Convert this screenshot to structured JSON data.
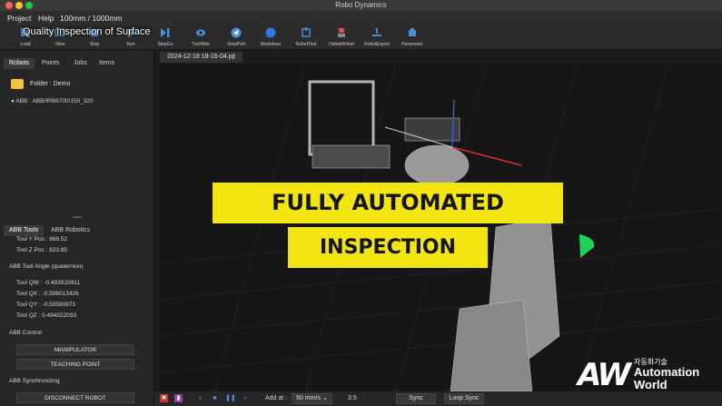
{
  "window": {
    "title": "Robo Dynamics"
  },
  "menu": [
    "Project",
    "Help",
    "100mm / 1000mm"
  ],
  "toolbar": [
    {
      "label": "Load",
      "icon": "load-icon",
      "color": "#4a90d9"
    },
    {
      "label": "View",
      "icon": "view-icon",
      "color": "#4a90d9"
    },
    {
      "label": "Stop",
      "icon": "stop-icon",
      "color": "#4a90d9"
    },
    {
      "label": "Run",
      "icon": "run-icon",
      "color": "#4a90d9"
    },
    {
      "label": "StepGo",
      "icon": "step-icon",
      "color": "#4a90d9"
    },
    {
      "label": "ToolHide",
      "icon": "eye-icon",
      "color": "#4a90d9"
    },
    {
      "label": "ViewPort",
      "icon": "send-icon",
      "color": "#4a90d9"
    },
    {
      "label": "WorkArea",
      "icon": "globe-icon",
      "color": "#2d7be0"
    },
    {
      "label": "RobotTool",
      "icon": "tool-icon",
      "color": "#4a90d9"
    },
    {
      "label": "DeleteRobot",
      "icon": "robot-icon",
      "color": "#d9534f"
    },
    {
      "label": "RobotExport",
      "icon": "export-icon",
      "color": "#4a90d9"
    },
    {
      "label": "Parameter",
      "icon": "parameter-icon",
      "color": "#4a90d9"
    }
  ],
  "overlay_title": "Quality Inspection of Surface",
  "left_tabs": [
    "Robots",
    "Points",
    "Jobs",
    "Items"
  ],
  "tree": {
    "folder": "Folder : Demo",
    "robot": "ABB : ABB/IRB6700/150_320"
  },
  "props_tabs": [
    "ABB Tools",
    "ABB Robotics"
  ],
  "props": {
    "tool_y": "Tool Y Pos : 866.52",
    "tool_z": "Tool Z Pos : 823.85",
    "angle_header": "ABB Tool Angle (quaternion)",
    "qw": "Tool QW : -0.493910911",
    "qx": "Tool QX : -0.506013426",
    "qy": "Tool QY : -0.50590973",
    "qz": "Tool QZ : 0.494022033",
    "control_header": "ABB Control",
    "manipulator": "MANIPULATOR",
    "teaching": "TEACHING POINT",
    "sync_header": "ABB Synchronizing",
    "disconnect": "DISCONNECT ROBOT"
  },
  "file_tab": "2024-12-18 18-16-04.pjt",
  "banners": {
    "line1": "FULLY AUTOMATED",
    "line2": "INSPECTION"
  },
  "bottom": {
    "add_at_label": "Add at :",
    "speed": "50 mm/s",
    "value": "3.5",
    "sync": "Sync",
    "loop_sync": "Loop Sync"
  },
  "watermark": {
    "korean": "자동화기술",
    "line1": "Automation",
    "line2": "World",
    "logo": "AW"
  },
  "colors": {
    "banner": "#f2e512",
    "accent": "#4a90d9",
    "folder": "#f5c242",
    "axis_red": "#e0302a",
    "axis_green": "#28c840",
    "axis_blue": "#2b5be0"
  }
}
